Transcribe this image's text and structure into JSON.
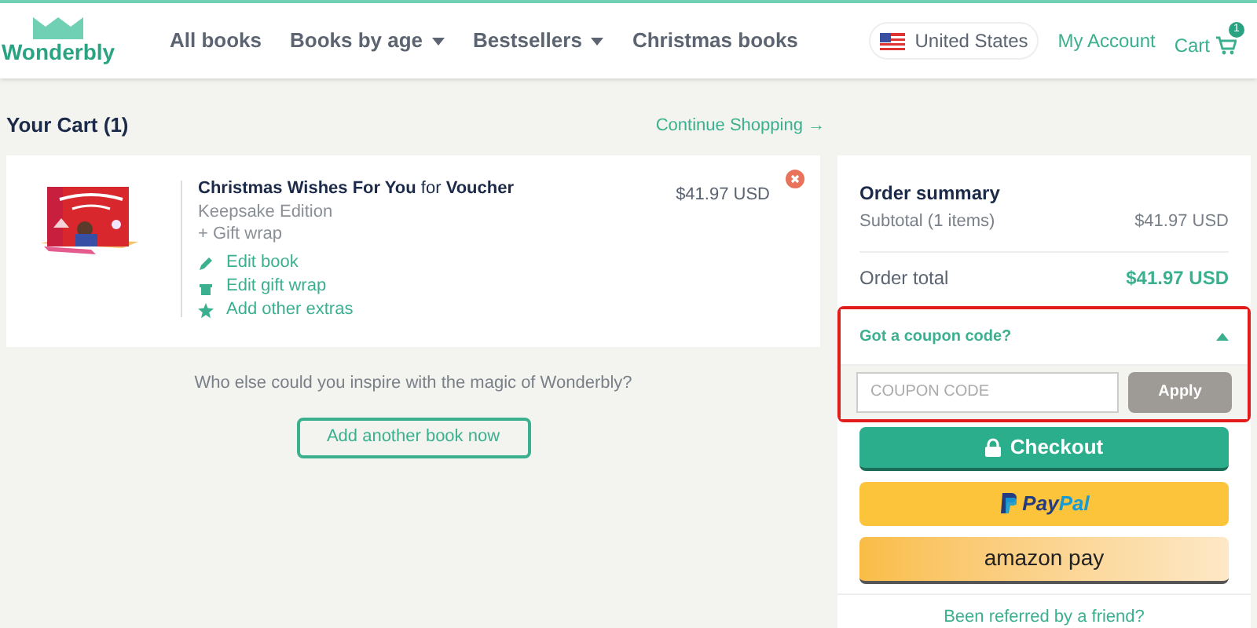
{
  "header": {
    "logo": "Wonderbly",
    "nav": [
      {
        "label": "All books",
        "has_menu": false
      },
      {
        "label": "Books by age",
        "has_menu": true
      },
      {
        "label": "Bestsellers",
        "has_menu": true
      },
      {
        "label": "Christmas books",
        "has_menu": false
      }
    ],
    "country": "United States",
    "account": "My Account",
    "cart": "Cart",
    "cart_count": "1"
  },
  "cart": {
    "title": "Your Cart (1)",
    "continue": "Continue Shopping →",
    "item": {
      "title": "**Christmas Wishes For You** for **Voucher**",
      "edition": "Keepsake Edition",
      "extra": "+ Gift wrap",
      "price": "$41.97 USD",
      "actions": [
        {
          "kind": "edit",
          "label": "Edit book"
        },
        {
          "kind": "gift",
          "label": "Edit gift wrap"
        },
        {
          "kind": "star",
          "label": "Add other extras"
        }
      ]
    },
    "prompt": "Who else could you inspire with the magic of Wonderbly?",
    "add_button": "Add another book now"
  },
  "summary": {
    "title": "Order summary",
    "subtotal_label": "Subtotal (1 items)",
    "subtotal": "$41.97 USD",
    "total_label": "Order total",
    "total": "$41.97 USD",
    "coupon": {
      "label": "Got a coupon code?",
      "expanded": true,
      "placeholder": "COUPON CODE",
      "apply": "Apply"
    },
    "checkout": "Checkout",
    "paypal_pay": "Pay",
    "paypal_pal": "Pal",
    "amazon": "amazon pay",
    "referral": "Been referred by a friend?"
  }
}
